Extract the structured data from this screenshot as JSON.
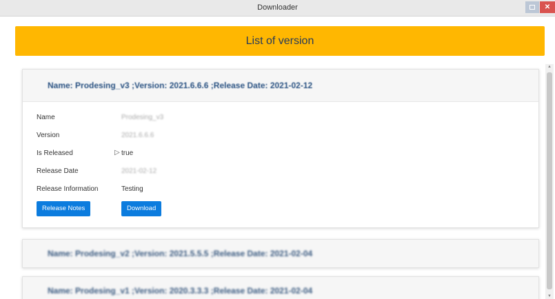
{
  "window": {
    "title": "Downloader",
    "restore_icon": "restore-icon",
    "close_icon": "close-icon",
    "close_glyph": "✕"
  },
  "banner": {
    "title": "List of version",
    "color": "#ffb701"
  },
  "versions": [
    {
      "header": "Name: Prodesing_v3 ;Version: 2021.6.6.6 ;Release Date: 2021-02-12",
      "expanded": true,
      "details": {
        "name_label": "Name",
        "name_value": "Prodesing_v3",
        "version_label": "Version",
        "version_value": "2021.6.6.6",
        "released_label": "Is Released",
        "released_value": "true",
        "date_label": "Release Date",
        "date_value": "2021-02-12",
        "info_label": "Release Information",
        "info_value": "Testing"
      },
      "buttons": {
        "release_notes": "Release Notes",
        "download": "Download"
      }
    },
    {
      "header": "Name: Prodesing_v2 ;Version: 2021.5.5.5 ;Release Date: 2021-02-04",
      "expanded": false
    },
    {
      "header": "Name: Prodesing_v1 ;Version: 2020.3.3.3 ;Release Date: 2021-02-04",
      "expanded": false
    }
  ],
  "colors": {
    "accent": "#0c7cde",
    "header_text": "#2a5282"
  }
}
